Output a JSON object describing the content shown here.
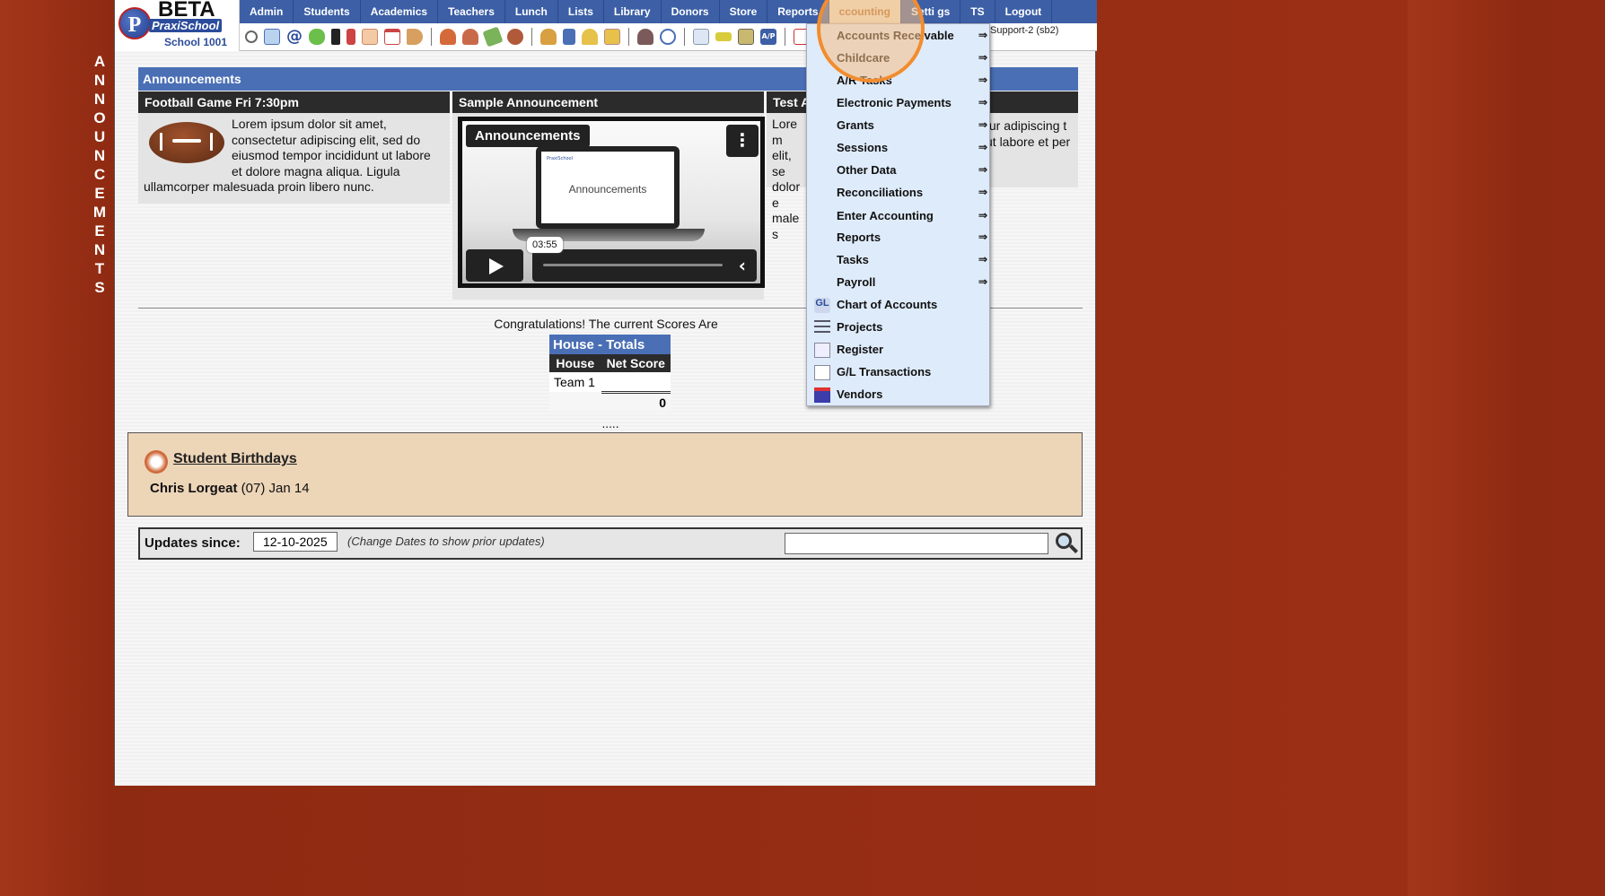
{
  "side_banner": [
    "A",
    "N",
    "N",
    "O",
    "U",
    "N",
    "C",
    "E",
    "M",
    "E",
    "N",
    "T",
    "S"
  ],
  "logo": {
    "beta": "BETA",
    "brand": "PraxiSchool",
    "school": "School 1001",
    "badge_letter": "P"
  },
  "menu": [
    {
      "label": "Admin"
    },
    {
      "label": "Students"
    },
    {
      "label": "Academics"
    },
    {
      "label": "Teachers"
    },
    {
      "label": "Lunch"
    },
    {
      "label": "Lists"
    },
    {
      "label": "Library"
    },
    {
      "label": "Donors"
    },
    {
      "label": "Store"
    },
    {
      "label": "Reports"
    },
    {
      "label": "ccounting"
    },
    {
      "label": "Setti gs"
    },
    {
      "label": "TS"
    },
    {
      "label": "Logout"
    }
  ],
  "user_tag": "Support-2 (sb2)",
  "announcements": {
    "header": "Announcements",
    "cards": [
      {
        "title": "Football Game Fri 7:30pm",
        "body": "Lorem ipsum dolor sit amet, consectetur adipiscing elit, sed do eiusmod tempor incididunt ut labore et dolore magna aliqua. Ligula ullamcorper malesuada proin libero nunc."
      },
      {
        "title": "Sample Announcement"
      },
      {
        "title": "Test A",
        "body": "Lorem elit, se dolore males"
      }
    ],
    "video": {
      "title": "Announcements",
      "screen_text": "Announcements",
      "time": "03:55",
      "mini_logo": "PraxiSchool"
    }
  },
  "scores": {
    "congrats": "Congratulations!  The current Scores Are",
    "caption": "House - Totals",
    "headers": [
      "House",
      "Net Score"
    ],
    "rows": [
      {
        "house": "Team 1",
        "score": ""
      }
    ],
    "total": "0",
    "dots": "....."
  },
  "birthdays": {
    "title": " Student Birthdays",
    "name": "Chris Lorgeat",
    "detail": " (07) Jan 14"
  },
  "updates": {
    "label": "Updates since:",
    "date": "12-10-2025",
    "note": "(Change Dates to show prior updates)",
    "search_value": ""
  },
  "dropdown": {
    "items": [
      {
        "label": "Accounts Rece vable",
        "arrow": "⇒"
      },
      {
        "label": "Childcare",
        "arrow": "⇒"
      },
      {
        "label": "A/R Tasks",
        "arrow": "⇒"
      },
      {
        "label": "Electronic Payments",
        "arrow": "⇒"
      },
      {
        "label": "Grants",
        "arrow": "⇒"
      },
      {
        "label": "Sessions",
        "arrow": "⇒"
      },
      {
        "label": "Other Data",
        "arrow": "⇒"
      },
      {
        "label": "Reconciliations",
        "arrow": "⇒"
      },
      {
        "label": "Enter Accounting",
        "arrow": "⇒"
      },
      {
        "label": "Reports",
        "arrow": "⇒"
      },
      {
        "label": "Tasks",
        "arrow": "⇒"
      },
      {
        "label": "Payroll",
        "arrow": "⇒"
      },
      {
        "label": "Chart of Accounts",
        "icon": "gl-icon"
      },
      {
        "label": "Projects",
        "icon": "list-icon"
      },
      {
        "label": "Register",
        "icon": "register-icon"
      },
      {
        "label": "G/L Transactions",
        "icon": "document-icon"
      },
      {
        "label": "Vendors",
        "icon": "store-icon"
      }
    ]
  },
  "colors": {
    "menu_bg": "#3c5fa6",
    "dropdown_bg": "#deebfa",
    "highlight": "#f28c2e",
    "birthday_bg": "#edd5b8"
  }
}
